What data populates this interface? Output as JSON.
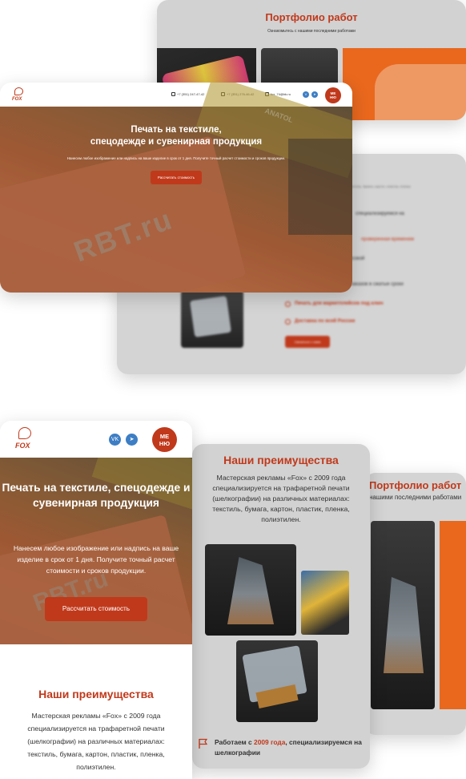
{
  "brand": {
    "logo_text": "FOX"
  },
  "colors": {
    "accent": "#c0391b",
    "card_gray": "#d2d2d2",
    "social": "#3d7ec4"
  },
  "desktop": {
    "portfolio": {
      "title": "Портфолио работ",
      "subtitle": "Ознакомьтесь с нашими последними работами"
    },
    "advantages": {
      "lines": [
        "шелкографии) на различных материалах: текстиль, бумага, картон, пластик, пленка",
        "специализируемся на",
        "проверенная временем",
        "высокой",
        "заказов в сжатые сроки",
        "Печать для маркетплейсов под ключ",
        "Доставка по всей России"
      ],
      "button": "Связаться с нами"
    },
    "hero": {
      "phone1": "+7 (351) 247-47-42",
      "phone2": "+7 (351) 276-46-42",
      "email": "fox_74@bk.ru",
      "menu": [
        "МЕ",
        "НЮ"
      ],
      "title_line1": "Печать на текстиле,",
      "title_line2": "спецодежде и сувенирная продукция",
      "subtitle": "Нанесем любое изображение или надпись на ваше изделие в срок от 1 дня. Получите точный расчет стоимости и сроков продукции.",
      "cta": "Рассчитать стоимость",
      "image_text": "RBT.ru",
      "banner_text": "ANATOL"
    }
  },
  "mobile": {
    "portfolio": {
      "title": "Портфолио работ",
      "subtitle": "нашими последними работами"
    },
    "advantages": {
      "title": "Наши преимущества",
      "text": "Мастерская рекламы «Fox» с 2009 года специализируется на трафаретной печати (шелкографии) на различных материалах: текстиль, бумага, картон, пластик, пленка, полиэтилен.",
      "feature_pre": "Работаем с ",
      "feature_hl": "2009 года",
      "feature_post": ", специализируемся на шелкографии"
    },
    "hero": {
      "social": [
        "VK",
        "TG"
      ],
      "menu": [
        "МЕ",
        "НЮ"
      ],
      "title": "Печать на текстиле, спецодежде и сувенирная продукция",
      "subtitle": "Нанесем любое изображение или надпись на ваше изделие в срок от 1 дня. Получите точный расчет стоимости и сроков продукции.",
      "cta": "Рассчитать стоимость",
      "adv_title": "Наши преимущества",
      "adv_text": "Мастерская рекламы «Fox» с 2009 года специализируется на трафаретной печати (шелкографии) на различных материалах: текстиль, бумага, картон, пластик, пленка, полиэтилен."
    }
  }
}
